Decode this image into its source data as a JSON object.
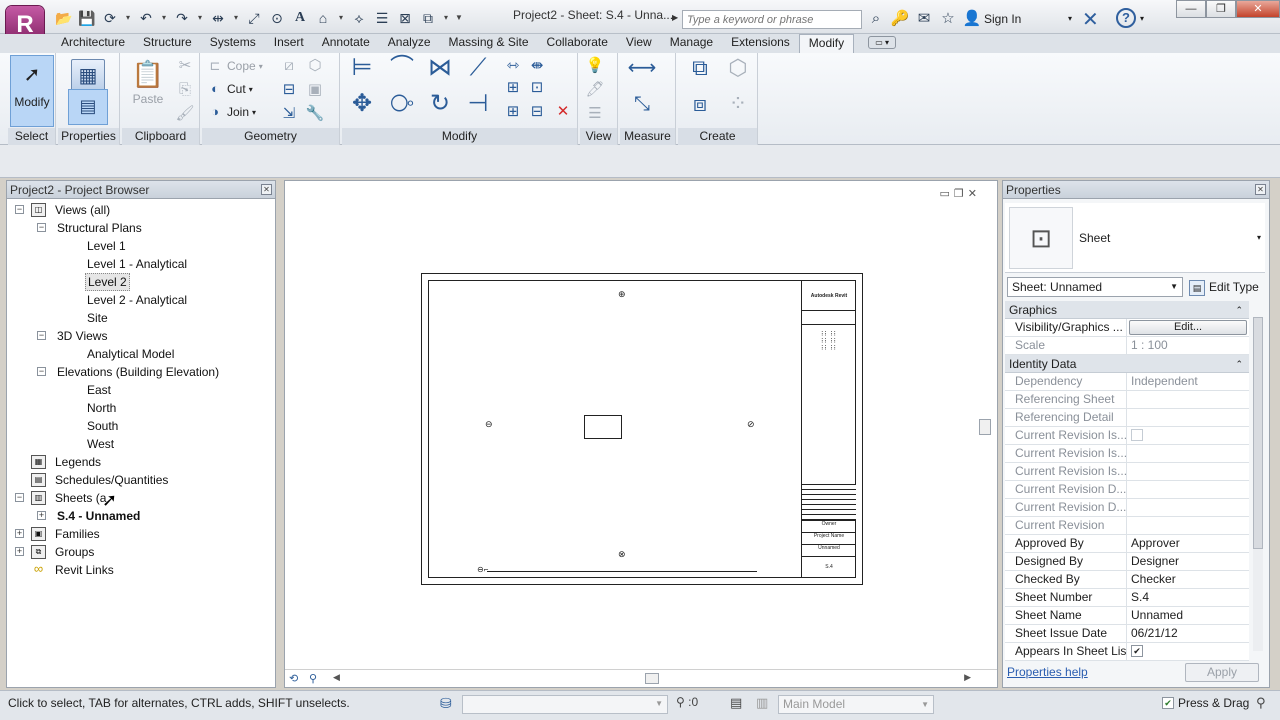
{
  "title_bar": {
    "app_letter": "R",
    "doc_title": "Project2 - Sheet: S.4 - Unna...",
    "search_placeholder": "Type a keyword or phrase",
    "sign_in": "Sign In"
  },
  "tabs": [
    "Architecture",
    "Structure",
    "Systems",
    "Insert",
    "Annotate",
    "Analyze",
    "Massing & Site",
    "Collaborate",
    "View",
    "Manage",
    "Extensions",
    "Modify"
  ],
  "active_tab": "Modify",
  "ribbon": {
    "select": {
      "label": "Select",
      "modify_btn": "Modify"
    },
    "properties": {
      "label": "Properties"
    },
    "clipboard": {
      "label": "Clipboard",
      "paste": "Paste"
    },
    "geometry": {
      "label": "Geometry",
      "cope": "Cope",
      "cut": "Cut",
      "join": "Join"
    },
    "modify": {
      "label": "Modify"
    },
    "view": {
      "label": "View"
    },
    "measure": {
      "label": "Measure"
    },
    "create": {
      "label": "Create"
    }
  },
  "project_browser": {
    "title": "Project2 - Project Browser",
    "items": [
      {
        "label": "Views (all)",
        "level": 0,
        "expander": "−",
        "icon": "views"
      },
      {
        "label": "Structural Plans",
        "level": 1,
        "expander": "−"
      },
      {
        "label": "Level 1",
        "level": 2
      },
      {
        "label": "Level 1 - Analytical",
        "level": 2
      },
      {
        "label": "Level 2",
        "level": 2,
        "selected": true
      },
      {
        "label": "Level 2 - Analytical",
        "level": 2
      },
      {
        "label": "Site",
        "level": 2
      },
      {
        "label": "3D Views",
        "level": 1,
        "expander": "−"
      },
      {
        "label": "Analytical Model",
        "level": 2
      },
      {
        "label": "Elevations (Building Elevation)",
        "level": 1,
        "expander": "−"
      },
      {
        "label": "East",
        "level": 2
      },
      {
        "label": "North",
        "level": 2
      },
      {
        "label": "South",
        "level": 2
      },
      {
        "label": "West",
        "level": 2
      },
      {
        "label": "Legends",
        "level": 0,
        "icon": "legend"
      },
      {
        "label": "Schedules/Quantities",
        "level": 0,
        "icon": "schedule"
      },
      {
        "label": "Sheets (a",
        "level": 0,
        "expander": "−",
        "icon": "sheet"
      },
      {
        "label": "S.4 - Unnamed",
        "level": 1,
        "expander": "+",
        "bold": true
      },
      {
        "label": "Families",
        "level": 0,
        "expander": "+",
        "icon": "family"
      },
      {
        "label": "Groups",
        "level": 0,
        "expander": "+",
        "icon": "group"
      },
      {
        "label": "Revit Links",
        "level": 0,
        "icon": "link"
      }
    ]
  },
  "sheet_titleblock": {
    "company": "Autodesk Revit",
    "owner": "Owner",
    "project_name": "Project Name",
    "sheet_name": "Unnamed",
    "sheet_number": "S.4"
  },
  "properties": {
    "title": "Properties",
    "type_name": "Sheet",
    "instance_selector": "Sheet: Unnamed",
    "edit_type": "Edit Type",
    "groups": [
      {
        "name": "Graphics",
        "rows": [
          {
            "name": "Visibility/Graphics ...",
            "value": "Edit...",
            "button": true
          },
          {
            "name": "Scale",
            "value": "1 : 100",
            "readonly": true
          }
        ]
      },
      {
        "name": "Identity Data",
        "rows": [
          {
            "name": "Dependency",
            "value": "Independent",
            "readonly": true
          },
          {
            "name": "Referencing Sheet",
            "value": "",
            "readonly": true
          },
          {
            "name": "Referencing Detail",
            "value": "",
            "readonly": true
          },
          {
            "name": "Current Revision Is...",
            "value": "",
            "readonly": true,
            "checkbox": "unchecked"
          },
          {
            "name": "Current Revision Is...",
            "value": "",
            "readonly": true
          },
          {
            "name": "Current Revision Is...",
            "value": "",
            "readonly": true
          },
          {
            "name": "Current Revision D...",
            "value": "",
            "readonly": true
          },
          {
            "name": "Current Revision D...",
            "value": "",
            "readonly": true
          },
          {
            "name": "Current Revision",
            "value": "",
            "readonly": true
          },
          {
            "name": "Approved By",
            "value": "Approver"
          },
          {
            "name": "Designed By",
            "value": "Designer"
          },
          {
            "name": "Checked By",
            "value": "Checker"
          },
          {
            "name": "Sheet Number",
            "value": "S.4"
          },
          {
            "name": "Sheet Name",
            "value": "Unnamed"
          },
          {
            "name": "Sheet Issue Date",
            "value": "06/21/12"
          },
          {
            "name": "Appears In Sheet List",
            "value": "",
            "checkbox": "checked"
          }
        ]
      }
    ],
    "help_link": "Properties help",
    "apply": "Apply"
  },
  "status_bar": {
    "message": "Click to select, TAB for alternates, CTRL adds, SHIFT unselects.",
    "filter_count": ":0",
    "model": "Main Model",
    "press_drag": "Press & Drag"
  }
}
